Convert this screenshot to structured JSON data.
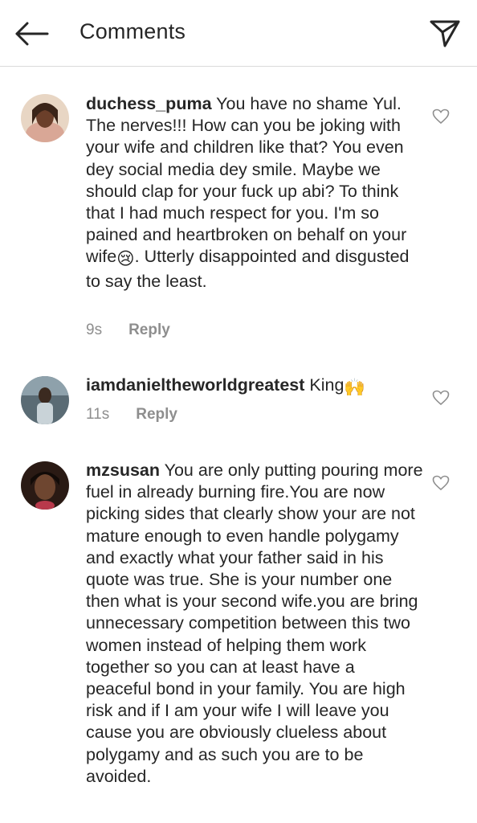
{
  "header": {
    "title": "Comments",
    "back_icon": "arrow-left-icon",
    "share_icon": "paper-plane-icon"
  },
  "comments": [
    {
      "username": "duchess_puma",
      "text_before_emoji": " You have no shame Yul. The nerves!!! How can you be joking with your wife and children like that? You even dey social media dey smile. Maybe we should clap for your fuck up abi?  To think that I had much respect for you.  I'm so pained and heartbroken on behalf on your wife",
      "emoji": "😢",
      "text_after_emoji": ". Utterly disappointed and disgusted to say the least.",
      "time": "9s",
      "reply_label": "Reply"
    },
    {
      "username": "iamdanieltheworldgreatest",
      "text_before_emoji": " King",
      "emoji": "🙌",
      "text_after_emoji": "",
      "time": "11s",
      "reply_label": "Reply"
    },
    {
      "username": "mzsusan",
      "text_before_emoji": " You are only putting pouring more fuel in already burning fire.You are now picking sides that clearly show your are not mature enough to even handle polygamy and exactly what your father said in his quote was true. She is your number one  then what is your second wife.you are bring unnecessary competition between this two women instead of helping them work together so you can at least have a peaceful bond in your family. You are high risk and if I am your wife I will leave you cause you are obviously clueless about polygamy and as such you are to be avoided.",
      "emoji": "",
      "text_after_emoji": "",
      "time": "",
      "reply_label": ""
    }
  ],
  "colors": {
    "text": "#262626",
    "meta": "#8e8e8e",
    "divider": "#dbdbdb"
  }
}
